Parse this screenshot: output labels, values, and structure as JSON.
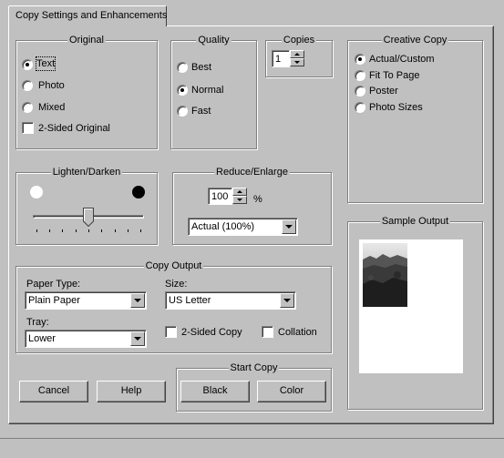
{
  "tab": {
    "label": "Copy Settings and Enhancements"
  },
  "original": {
    "title": "Original",
    "options": [
      {
        "label": "Text",
        "selected": true
      },
      {
        "label": "Photo",
        "selected": false
      },
      {
        "label": "Mixed",
        "selected": false
      }
    ],
    "two_sided_label": "2-Sided Original"
  },
  "quality": {
    "title": "Quality",
    "options": [
      {
        "label": "Best",
        "selected": false
      },
      {
        "label": "Normal",
        "selected": true
      },
      {
        "label": "Fast",
        "selected": false
      }
    ]
  },
  "copies": {
    "title": "Copies",
    "value": "1"
  },
  "creative_copy": {
    "title": "Creative Copy",
    "options": [
      {
        "label": "Actual/Custom",
        "selected": true
      },
      {
        "label": "Fit To Page",
        "selected": false
      },
      {
        "label": "Poster",
        "selected": false
      },
      {
        "label": "Photo Sizes",
        "selected": false
      }
    ]
  },
  "lighten_darken": {
    "title": "Lighten/Darken",
    "level": 0.5
  },
  "reduce_enlarge": {
    "title": "Reduce/Enlarge",
    "value": "100",
    "unit": "%",
    "preset": "Actual (100%)"
  },
  "sample_output": {
    "title": "Sample Output"
  },
  "copy_output": {
    "title": "Copy Output",
    "paper_type_label": "Paper Type:",
    "paper_type_value": "Plain Paper",
    "size_label": "Size:",
    "size_value": "US Letter",
    "tray_label": "Tray:",
    "tray_value": "Lower",
    "two_sided_copy_label": "2-Sided Copy",
    "collation_label": "Collation"
  },
  "buttons": {
    "cancel": "Cancel",
    "help": "Help"
  },
  "start_copy": {
    "title": "Start Copy",
    "black": "Black",
    "color": "Color"
  },
  "colors": {
    "face": "#c0c0c0",
    "shadow": "#808080",
    "highlight": "#ffffff"
  }
}
